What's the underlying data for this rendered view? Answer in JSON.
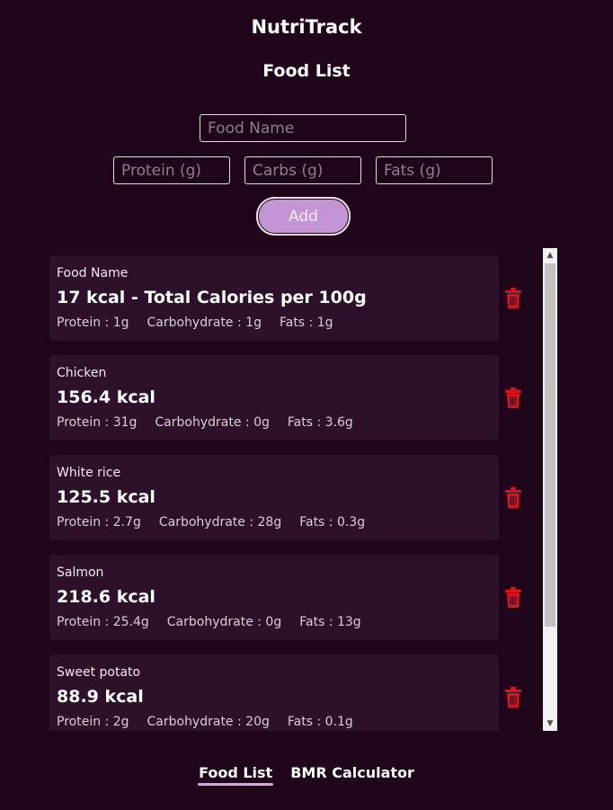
{
  "header": {
    "app_title": "NutriTrack",
    "page_title": "Food List"
  },
  "form": {
    "food_name_placeholder": "Food Name",
    "protein_placeholder": "Protein (g)",
    "carbs_placeholder": "Carbs (g)",
    "fats_placeholder": "Fats (g)",
    "add_label": "Add"
  },
  "foods": [
    {
      "name": "Food Name",
      "kcal": "17 kcal - Total Calories per 100g",
      "protein": "Protein : 1g",
      "carbs": "Carbohydrate : 1g",
      "fats": "Fats : 1g"
    },
    {
      "name": "Chicken",
      "kcal": "156.4 kcal",
      "protein": "Protein : 31g",
      "carbs": "Carbohydrate : 0g",
      "fats": "Fats : 3.6g"
    },
    {
      "name": "White rice",
      "kcal": "125.5 kcal",
      "protein": "Protein : 2.7g",
      "carbs": "Carbohydrate : 28g",
      "fats": "Fats : 0.3g"
    },
    {
      "name": "Salmon",
      "kcal": "218.6 kcal",
      "protein": "Protein : 25.4g",
      "carbs": "Carbohydrate : 0g",
      "fats": "Fats : 13g"
    },
    {
      "name": "Sweet potato",
      "kcal": "88.9 kcal",
      "protein": "Protein : 2g",
      "carbs": "Carbohydrate : 20g",
      "fats": "Fats : 0.1g"
    }
  ],
  "icons": {
    "delete": "trash-icon",
    "scroll_up": "▲",
    "scroll_down": "▼"
  },
  "colors": {
    "background": "#1f0519",
    "card": "#2d1029",
    "accent": "#c495d5",
    "delete": "#e0101f"
  },
  "bottom_nav": {
    "items": [
      {
        "label": "Food List",
        "active": true
      },
      {
        "label": "BMR Calculator",
        "active": false
      }
    ]
  }
}
